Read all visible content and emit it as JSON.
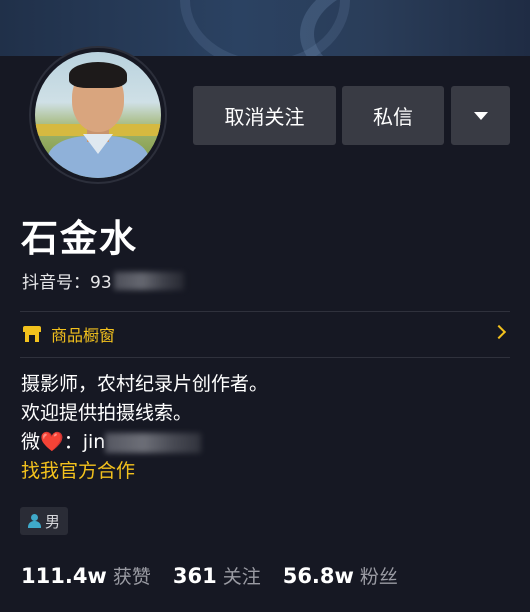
{
  "profile": {
    "name": "石金水",
    "douyin_id_label": "抖音号：93",
    "douyin_id_blurred": true
  },
  "actions": {
    "unfollow_label": "取消关注",
    "message_label": "私信",
    "more_icon": "triangle-down-icon"
  },
  "shop": {
    "label": "商品橱窗",
    "icon": "shop-icon",
    "accent": "#f2c11d"
  },
  "bio": {
    "line1": "摄影师，农村纪录片创作者。",
    "line2": "欢迎提供拍摄线索。",
    "line3_prefix": "微",
    "line3_heart": "❤️",
    "line3_suffix": "：jin",
    "cooperate": "找我官方合作"
  },
  "gender": {
    "label": "男",
    "icon": "male-person-icon"
  },
  "stats": [
    {
      "value": "111.4w",
      "label": "获赞"
    },
    {
      "value": "361",
      "label": "关注"
    },
    {
      "value": "56.8w",
      "label": "粉丝"
    }
  ],
  "colors": {
    "background": "#161823",
    "button": "#393b44",
    "accent": "#f2c11d"
  }
}
